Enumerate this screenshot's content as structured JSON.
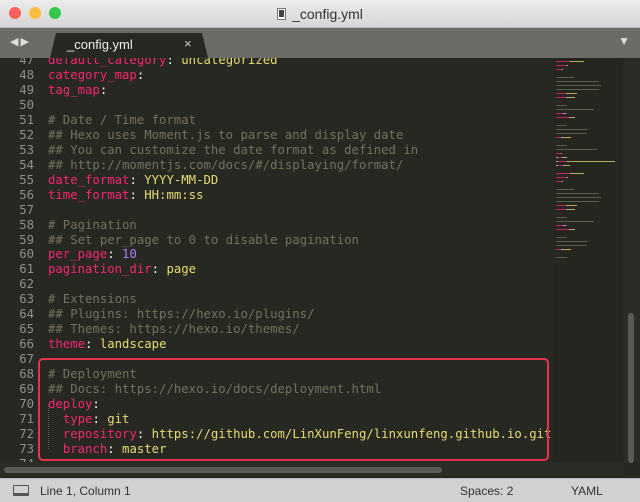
{
  "window": {
    "title": "_config.yml",
    "traffic_lights": {
      "close": "#fc605b",
      "minimize": "#fdbc40",
      "zoom": "#34c84a"
    }
  },
  "tabs": [
    {
      "label": "_config.yml",
      "close": "×",
      "active": true
    }
  ],
  "nav": {
    "back": "◀",
    "forward": "▶",
    "menu": "▼"
  },
  "editor": {
    "first_line": 47,
    "lines": [
      [
        [
          "k",
          "default_category"
        ],
        [
          "p",
          ": "
        ],
        [
          "v",
          "uncategorized"
        ]
      ],
      [
        [
          "k",
          "category_map"
        ],
        [
          "p",
          ":"
        ]
      ],
      [
        [
          "k",
          "tag_map"
        ],
        [
          "p",
          ":"
        ]
      ],
      [],
      [
        [
          "c",
          "# Date / Time format"
        ]
      ],
      [
        [
          "c",
          "## Hexo uses Moment.js to parse and display date"
        ]
      ],
      [
        [
          "c",
          "## You can customize the date format as defined in"
        ]
      ],
      [
        [
          "c",
          "## http://momentjs.com/docs/#/displaying/format/"
        ]
      ],
      [
        [
          "k",
          "date_format"
        ],
        [
          "p",
          ": "
        ],
        [
          "v",
          "YYYY-MM-DD"
        ]
      ],
      [
        [
          "k",
          "time_format"
        ],
        [
          "p",
          ": "
        ],
        [
          "v",
          "HH:mm:ss"
        ]
      ],
      [],
      [
        [
          "c",
          "# Pagination"
        ]
      ],
      [
        [
          "c",
          "## Set per_page to 0 to disable pagination"
        ]
      ],
      [
        [
          "k",
          "per_page"
        ],
        [
          "p",
          ": "
        ],
        [
          "n",
          "10"
        ]
      ],
      [
        [
          "k",
          "pagination_dir"
        ],
        [
          "p",
          ": "
        ],
        [
          "v",
          "page"
        ]
      ],
      [],
      [
        [
          "c",
          "# Extensions"
        ]
      ],
      [
        [
          "c",
          "## Plugins: https://hexo.io/plugins/"
        ]
      ],
      [
        [
          "c",
          "## Themes: https://hexo.io/themes/"
        ]
      ],
      [
        [
          "k",
          "theme"
        ],
        [
          "p",
          ": "
        ],
        [
          "v",
          "landscape"
        ]
      ],
      [],
      [
        [
          "c",
          "# Deployment"
        ]
      ],
      [
        [
          "c",
          "## Docs: https://hexo.io/docs/deployment.html"
        ]
      ],
      [
        [
          "k",
          "deploy"
        ],
        [
          "p",
          ":"
        ]
      ],
      [
        [
          "p",
          "  "
        ],
        [
          "k",
          "type"
        ],
        [
          "p",
          ": "
        ],
        [
          "v",
          "git"
        ]
      ],
      [
        [
          "p",
          "  "
        ],
        [
          "k",
          "repository"
        ],
        [
          "p",
          ": "
        ],
        [
          "v",
          "https://github.com/LinXunFeng/linxunfeng.github.io.git"
        ]
      ],
      [
        [
          "p",
          "  "
        ],
        [
          "k",
          "branch"
        ],
        [
          "p",
          ": "
        ],
        [
          "v",
          "master"
        ]
      ],
      []
    ]
  },
  "status": {
    "position": "Line 1, Column 1",
    "indentation": "Spaces: 2",
    "syntax": "YAML"
  },
  "colors": {
    "highlight_border": "#e5334b",
    "background": "#272822"
  }
}
